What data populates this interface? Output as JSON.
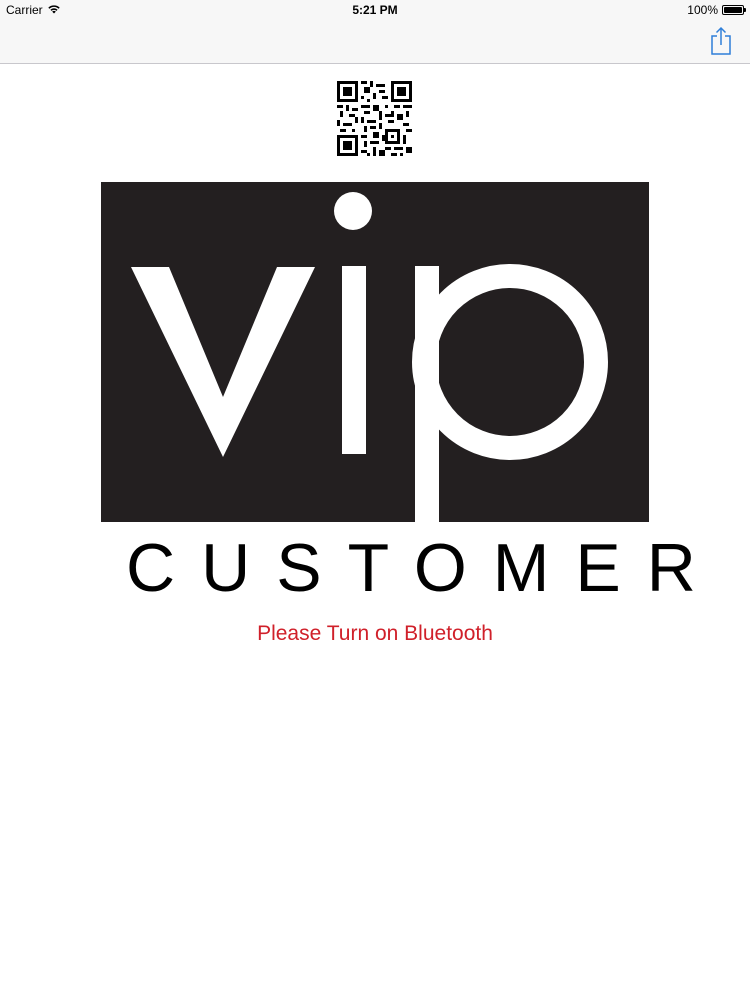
{
  "status_bar": {
    "carrier": "Carrier",
    "time": "5:21 PM",
    "battery": "100%",
    "icons": [
      "wifi-icon",
      "battery-icon"
    ]
  },
  "nav_bar": {
    "share_icon": "share-icon",
    "accent_color": "#2f7fd9"
  },
  "content": {
    "qr_icon": "qr-code-image",
    "logo_text": "vip",
    "logo_subtitle": "CUSTOMER",
    "status_message": "Please Turn on Bluetooth",
    "status_color": "#d0202a",
    "logo_background": "#231f20"
  }
}
